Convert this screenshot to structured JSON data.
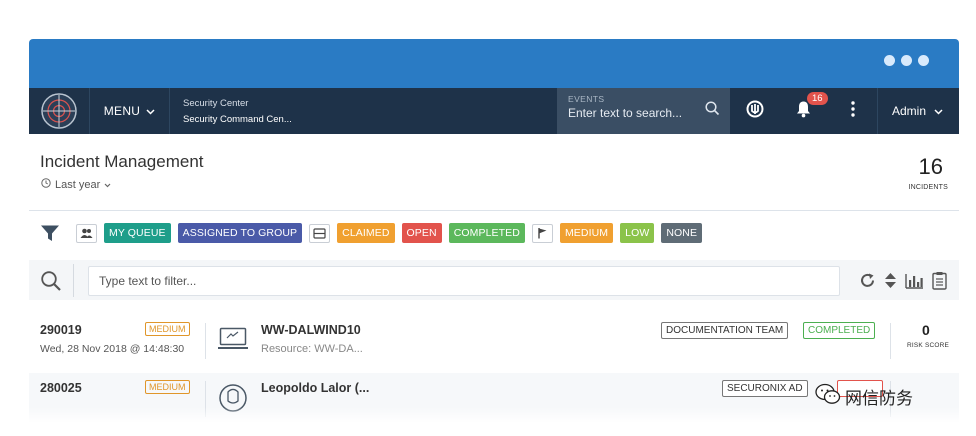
{
  "window": {
    "accent": "#2a7bc4",
    "nav_bg": "#1e3249"
  },
  "nav": {
    "menu_label": "MENU",
    "breadcrumb_top": "Security Center",
    "breadcrumb_bottom": "Security Command Cen...",
    "search_label": "EVENTS",
    "search_placeholder": "Enter text to search...",
    "notification_count": "16",
    "user_label": "Admin"
  },
  "header": {
    "title": "Incident Management",
    "time_range": "Last year",
    "incident_count": "16",
    "incident_count_label": "INCIDENTS"
  },
  "filters": {
    "my_queue": {
      "label": "MY QUEUE",
      "color": "#1e9e8a"
    },
    "assigned_group": {
      "label": "ASSIGNED TO GROUP",
      "color": "#4a5aa8"
    },
    "claimed": {
      "label": "CLAIMED",
      "color": "#f0a030"
    },
    "open": {
      "label": "OPEN",
      "color": "#e2534c"
    },
    "completed": {
      "label": "COMPLETED",
      "color": "#5cb85c"
    },
    "medium": {
      "label": "MEDIUM",
      "color": "#f0a030"
    },
    "low": {
      "label": "LOW",
      "color": "#8bc34a"
    },
    "none": {
      "label": "NONE",
      "color": "#5f6c76"
    }
  },
  "search": {
    "placeholder": "Type text to filter..."
  },
  "incidents": [
    {
      "id": "290019",
      "date": "Wed, 28 Nov 2018 @ 14:48:30",
      "severity": "MEDIUM",
      "name": "WW-DALWIND10",
      "resource": "Resource: WW-DA...",
      "team": "DOCUMENTATION TEAM",
      "status": "COMPLETED",
      "risk_score": "0",
      "risk_label": "RISK SCORE"
    },
    {
      "id": "280025",
      "severity": "MEDIUM",
      "name": "Leopoldo Lalor (...",
      "team": "SECURONIX AD"
    }
  ],
  "watermark": {
    "text": "网信防务"
  }
}
